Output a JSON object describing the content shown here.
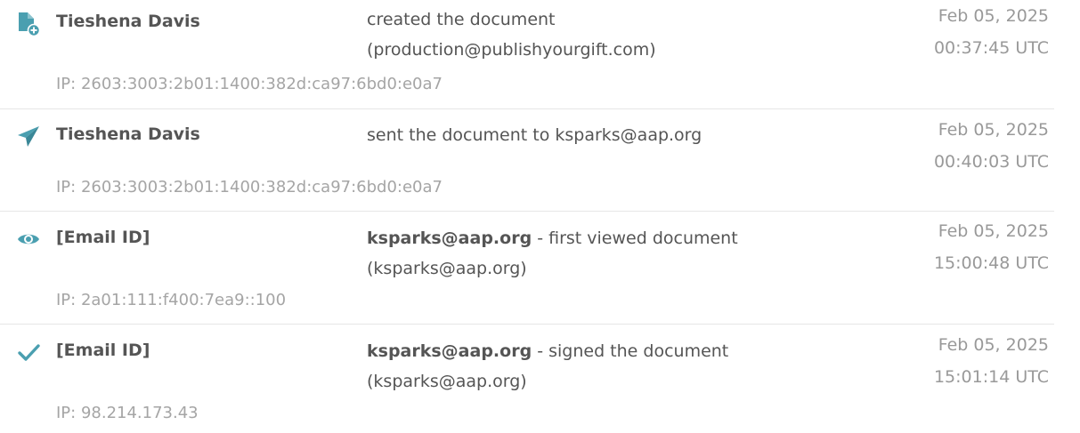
{
  "colors": {
    "icon": "#4a9fb0",
    "text": "#555555",
    "muted": "#999999",
    "ip": "#a5a5a5"
  },
  "events": [
    {
      "icon": "document-add-icon",
      "actor": "Tieshena Davis",
      "action_bold": "",
      "action_line1": "created the document",
      "action_line2": "(production@publishyourgift.com)",
      "date": "Feb 05, 2025",
      "time": "00:37:45 UTC",
      "ip": "IP: 2603:3003:2b01:1400:382d:ca97:6bd0:e0a7"
    },
    {
      "icon": "paper-plane-icon",
      "actor": "Tieshena Davis",
      "action_bold": "",
      "action_line1": "sent the document to ksparks@aap.org",
      "action_line2": "",
      "date": "Feb 05, 2025",
      "time": "00:40:03 UTC",
      "ip": "IP: 2603:3003:2b01:1400:382d:ca97:6bd0:e0a7"
    },
    {
      "icon": "eye-icon",
      "actor": "[Email ID]",
      "action_bold": "ksparks@aap.org",
      "action_line1": " - first viewed document",
      "action_line2": "(ksparks@aap.org)",
      "date": "Feb 05, 2025",
      "time": "15:00:48 UTC",
      "ip": "IP: 2a01:111:f400:7ea9::100"
    },
    {
      "icon": "checkmark-icon",
      "actor": "[Email ID]",
      "action_bold": "ksparks@aap.org",
      "action_line1": " - signed the document",
      "action_line2": "(ksparks@aap.org)",
      "date": "Feb 05, 2025",
      "time": "15:01:14 UTC",
      "ip": "IP: 98.214.173.43"
    }
  ]
}
